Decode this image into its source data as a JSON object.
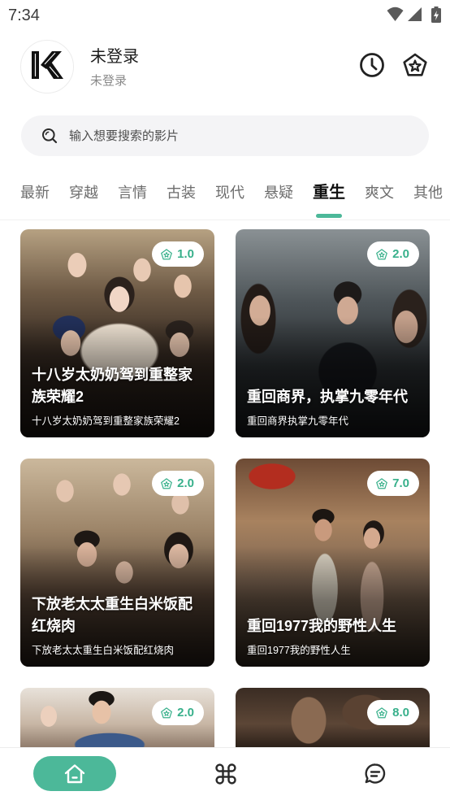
{
  "status_bar": {
    "time": "7:34",
    "icons": [
      "wifi-icon",
      "signal-icon",
      "battery-charging-icon"
    ]
  },
  "profile": {
    "logo_text": "K",
    "name": "未登录",
    "status": "未登录"
  },
  "header_actions": [
    {
      "icon": "history-clock-icon"
    },
    {
      "icon": "favorites-star-icon"
    }
  ],
  "search": {
    "placeholder": "输入想要搜索的影片",
    "value": "",
    "icon": "search-icon"
  },
  "tabs": [
    {
      "label": "最新",
      "selected": false
    },
    {
      "label": "穿越",
      "selected": false
    },
    {
      "label": "言情",
      "selected": false
    },
    {
      "label": "古装",
      "selected": false
    },
    {
      "label": "现代",
      "selected": false
    },
    {
      "label": "悬疑",
      "selected": false
    },
    {
      "label": "重生",
      "selected": true
    },
    {
      "label": "爽文",
      "selected": false
    },
    {
      "label": "其他",
      "selected": false
    }
  ],
  "cards": [
    {
      "rating": "1.0",
      "title": "十八岁太奶奶驾到重整家族荣耀2",
      "subtitle": "十八岁太奶奶驾到重整家族荣耀2"
    },
    {
      "rating": "2.0",
      "title": "重回商界，执掌九零年代",
      "subtitle": "重回商界执掌九零年代"
    },
    {
      "rating": "2.0",
      "title": "下放老太太重生白米饭配红烧肉",
      "subtitle": "下放老太太重生白米饭配红烧肉"
    },
    {
      "rating": "7.0",
      "title": "重回1977我的野性人生",
      "subtitle": "重回1977我的野性人生"
    },
    {
      "rating": "2.0"
    },
    {
      "rating": "8.0"
    }
  ],
  "bottom_nav": [
    {
      "icon": "home-icon",
      "active": true
    },
    {
      "icon": "category-icon",
      "active": false
    },
    {
      "icon": "message-icon",
      "active": false
    }
  ],
  "colors": {
    "accent": "#4cb899",
    "rating_text": "#38b08b",
    "text_primary": "#1c1c1c",
    "text_secondary": "#8a8a8a",
    "tab_text": "#6d6d6d",
    "search_bg": "#f4f4f6",
    "icon_dark": "#2a2a2a"
  }
}
